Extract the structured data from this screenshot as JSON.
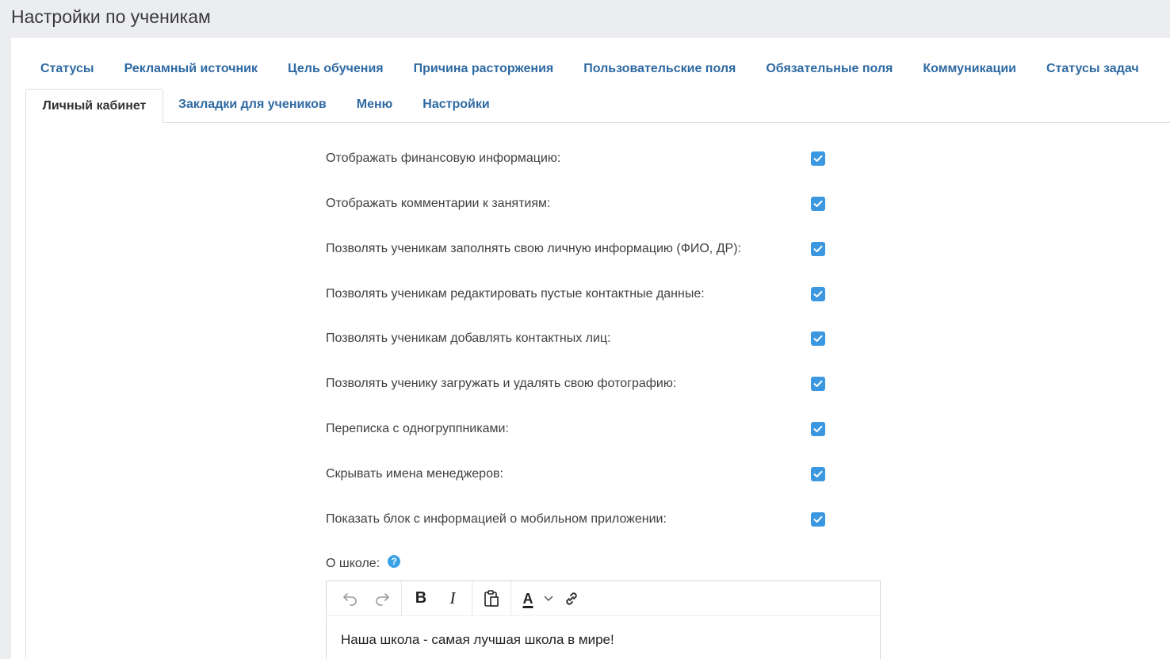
{
  "page": {
    "title": "Настройки по ученикам"
  },
  "tabs_row1": [
    "Статусы",
    "Рекламный источник",
    "Цель обучения",
    "Причина расторжения",
    "Пользовательские поля",
    "Обязательные поля",
    "Коммуникации",
    "Статусы задач"
  ],
  "active_tab": "Личный кабинет",
  "tabs_row2": [
    "Закладки для учеников",
    "Меню",
    "Настройки"
  ],
  "settings": [
    {
      "label": "Отображать финансовую информацию:",
      "checked": true
    },
    {
      "label": "Отображать комментарии к занятиям:",
      "checked": true
    },
    {
      "label": "Позволять ученикам заполнять свою личную информацию (ФИО, ДР):",
      "checked": true
    },
    {
      "label": "Позволять ученикам редактировать пустые контактные данные:",
      "checked": true
    },
    {
      "label": "Позволять ученикам добавлять контактных лиц:",
      "checked": true
    },
    {
      "label": "Позволять ученику загружать и удалять свою фотографию:",
      "checked": true
    },
    {
      "label": "Переписка с одногруппниками:",
      "checked": true
    },
    {
      "label": "Скрывать имена менеджеров:",
      "checked": true
    },
    {
      "label": "Показать блок с информацией о мобильном приложении:",
      "checked": true
    }
  ],
  "about": {
    "label": "О школе:",
    "help_glyph": "?",
    "content": "Наша школа - самая лучшая школа в мире!"
  },
  "toolbar": {
    "bold": "B",
    "italic": "I",
    "text_color": "A"
  },
  "colors": {
    "accent": "#3b97e0",
    "tab_text": "#2f6aa3"
  }
}
